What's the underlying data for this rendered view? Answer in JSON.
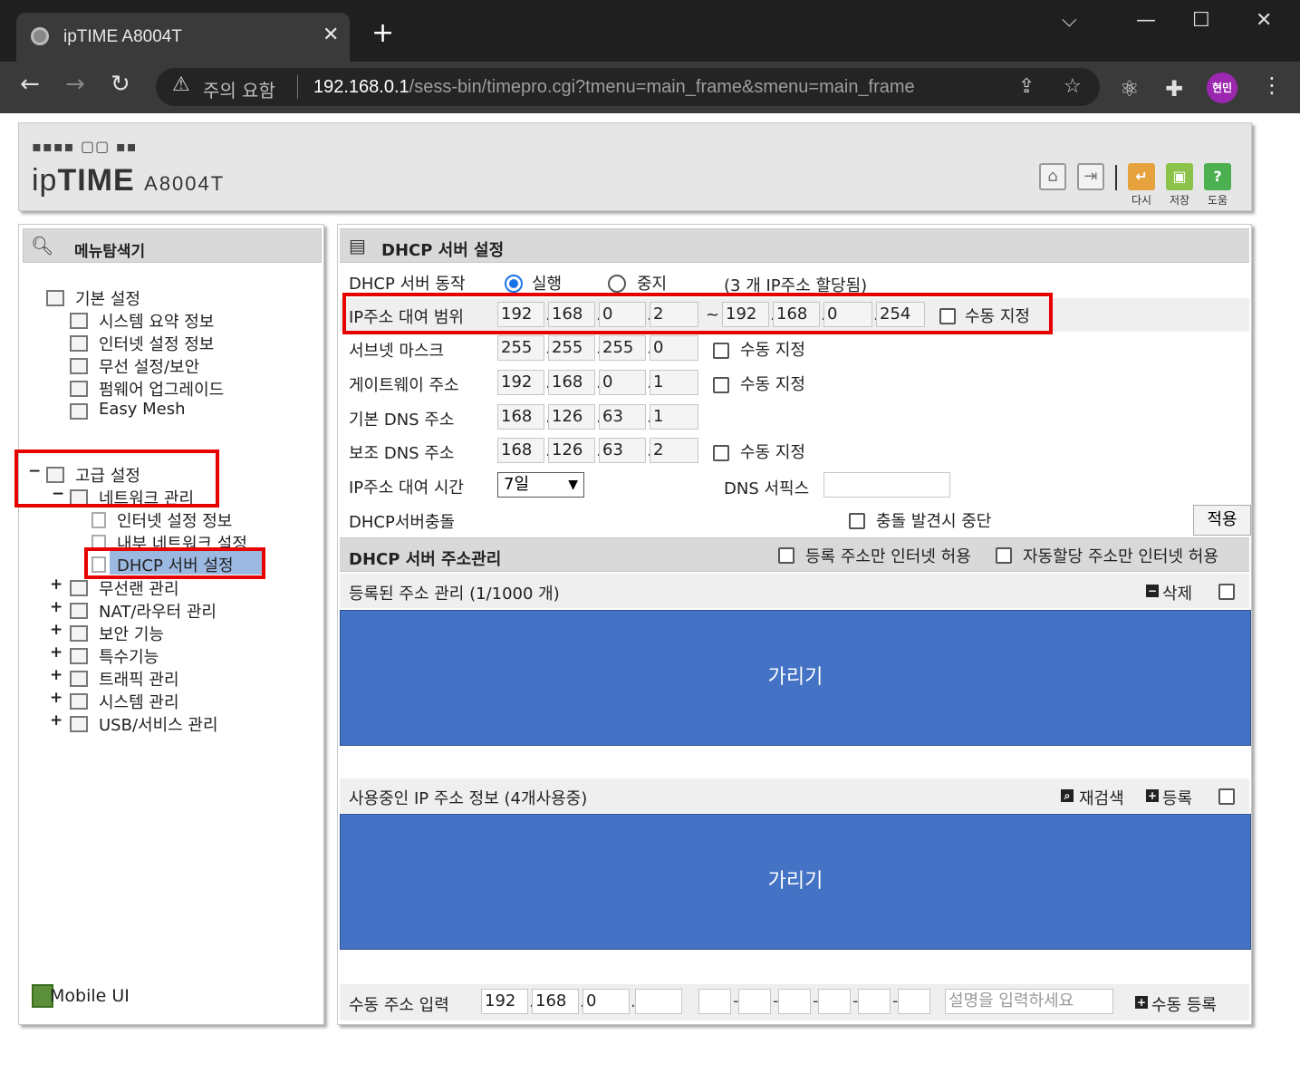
{
  "browser": {
    "tab_title": "ipTIME A8004T",
    "tab_close": "✕",
    "new_tab": "+",
    "win_min": "—",
    "win_max": "☐",
    "win_close": "✕",
    "win_chevron": "⌵",
    "warn_label": "주의 요함",
    "url_host": "192.168.0.1",
    "url_path": "/sess-bin/timepro.cgi?tmenu=main_frame&smenu=main_frame",
    "profile": "현민"
  },
  "header": {
    "logo_dots": "▪▪▪▪ ▢▢ ▪▪",
    "logo_ip": "ip",
    "logo_time": "TIME",
    "logo_model": "A8004T",
    "btn_redo": "다시",
    "btn_save": "저장",
    "btn_help": "도움"
  },
  "left": {
    "title": "메뉴탐색기",
    "basic": "기본 설정",
    "basic_items": [
      "시스템 요약 정보",
      "인터넷 설정 정보",
      "무선 설정/보안",
      "펌웨어 업그레이드",
      "Easy Mesh"
    ],
    "advanced": "고급 설정",
    "network": "네트워크 관리",
    "network_items": [
      "인터넷 설정 정보",
      "내부 네트워크 설정",
      "DHCP 서버 설정"
    ],
    "advanced_items": [
      "무선랜 관리",
      "NAT/라우터 관리",
      "보안 기능",
      "특수기능",
      "트래픽 관리",
      "시스템 관리",
      "USB/서비스 관리"
    ],
    "minus": "−",
    "plus": "+",
    "mobile_ui": "Mobile UI"
  },
  "main": {
    "title": "DHCP 서버 설정",
    "op_label": "DHCP 서버 동작",
    "op_run": "실행",
    "op_stop": "중지",
    "op_note": "(3 개 IP주소 할당됨)",
    "range_label": "IP주소 대여 범위",
    "range_start": [
      "192",
      "168",
      "0",
      "2"
    ],
    "range_tilde": "~",
    "range_end": [
      "192",
      "168",
      "0",
      "254"
    ],
    "manual": "수동 지정",
    "subnet_label": "서브넷 마스크",
    "subnet": [
      "255",
      "255",
      "255",
      "0"
    ],
    "gateway_label": "게이트웨이 주소",
    "gateway": [
      "192",
      "168",
      "0",
      "1"
    ],
    "dns1_label": "기본 DNS 주소",
    "dns1": [
      "168",
      "126",
      "63",
      "1"
    ],
    "dns2_label": "보조 DNS 주소",
    "dns2": [
      "168",
      "126",
      "63",
      "2"
    ],
    "lease_label": "IP주소 대여 시간",
    "lease_value": "7일",
    "dns_suffix_label": "DNS 서픽스",
    "conflict_label": "DHCP서버충돌",
    "conflict_stop": "충돌 발견시 중단",
    "apply": "적용",
    "mgmt_title": "DHCP 서버 주소관리",
    "only_registered": "등록 주소만 인터넷 허용",
    "only_auto": "자동할당 주소만 인터넷 허용",
    "registered_label": "등록된 주소 관리 (1/1000 개)",
    "delete": "삭제",
    "mask1": "가리기",
    "inuse_label": "사용중인 IP 주소 정보 (4개사용중)",
    "rescan": "재검색",
    "register": "등록",
    "mask2": "가리기",
    "manual_input_label": "수동 주소 입력",
    "manual_ip": [
      "192",
      "168",
      "0",
      ""
    ],
    "desc_placeholder": "설명을 입력하세요",
    "manual_register": "수동 등록",
    "dash": "-"
  }
}
